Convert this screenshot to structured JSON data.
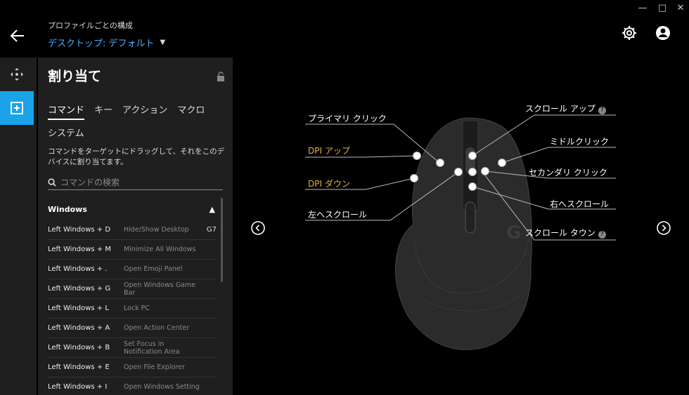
{
  "window": {
    "minimize": "—",
    "maximize": "□",
    "close": "✕"
  },
  "header": {
    "profile_label": "プロファイルごとの構成",
    "profile_value": "デスクトップ: デフォルト"
  },
  "panel": {
    "title": "割り当て",
    "tabs": [
      "コマンド",
      "キー",
      "アクション",
      "マクロ",
      "システム"
    ],
    "description": "コマンドをターゲットにドラッグして、それをこのデバイスに割り当てます。",
    "search_placeholder": "コマンドの検索",
    "group": "Windows",
    "rows": [
      {
        "key": "Left Windows + D",
        "action": "Hide/Show Desktop",
        "tag": "G7"
      },
      {
        "key": "Left Windows + M",
        "action": "Minimize All Windows",
        "tag": ""
      },
      {
        "key": "Left Windows + .",
        "action": "Open Emoji Panel",
        "tag": ""
      },
      {
        "key": "Left Windows + G",
        "action": "Open Windows Game Bar",
        "tag": ""
      },
      {
        "key": "Left Windows + L",
        "action": "Lock PC",
        "tag": ""
      },
      {
        "key": "Left Windows + A",
        "action": "Open Action Center",
        "tag": ""
      },
      {
        "key": "Left Windows + B",
        "action": "Set Focus in Notification Area",
        "tag": ""
      },
      {
        "key": "Left Windows + E",
        "action": "Open File Explorer",
        "tag": ""
      },
      {
        "key": "Left Windows + I",
        "action": "Open Windows Setting",
        "tag": ""
      }
    ]
  },
  "labels": {
    "primary_click": "プライマリ クリック",
    "dpi_up": "DPI アップ",
    "dpi_down": "DPI ダウン",
    "left_scroll": "左へスクロール",
    "scroll_up": "スクロール アップ",
    "middle_click": "ミドルクリック",
    "secondary_click": "セカンダリ クリック",
    "right_scroll": "右へスクロール",
    "scroll_down": "スクロール タウン",
    "help": "?"
  },
  "colors": {
    "accent": "#1aa3e8",
    "link": "#4ab0ff",
    "dpi": "#e5b53b"
  }
}
